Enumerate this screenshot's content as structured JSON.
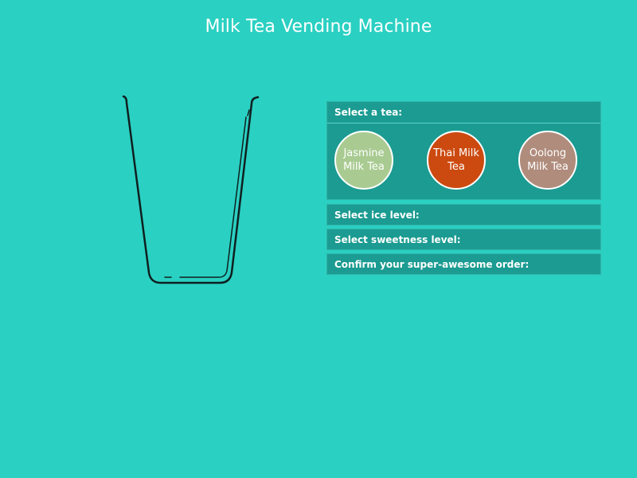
{
  "page": {
    "title": "Milk Tea Vending Machine"
  },
  "colors": {
    "background": "#2ad0c2",
    "panel": "#1b9b91",
    "cup_outline": "#0f1f1f"
  },
  "steps": {
    "tea": {
      "label": "Select a tea:",
      "options": [
        {
          "label": "Jasmine Milk Tea",
          "color": "#a9cb92"
        },
        {
          "label": "Thai Milk Tea",
          "color": "#cc4a10"
        },
        {
          "label": "Oolong Milk Tea",
          "color": "#b08c7c"
        }
      ]
    },
    "ice": {
      "label": "Select ice level:"
    },
    "sweetness": {
      "label": "Select sweetness level:"
    },
    "confirm": {
      "label": "Confirm your super-awesome order:"
    }
  }
}
